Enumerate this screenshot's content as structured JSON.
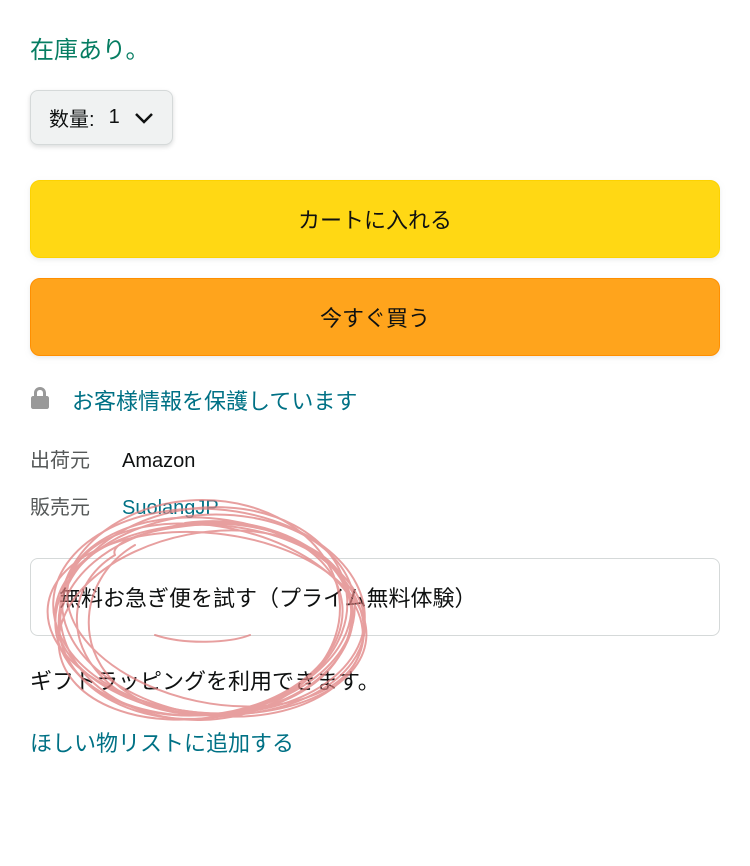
{
  "stock_status": "在庫あり。",
  "quantity": {
    "label": "数量:",
    "value": "1"
  },
  "buttons": {
    "add_to_cart": "カートに入れる",
    "buy_now": "今すぐ買う"
  },
  "secure": {
    "text": "お客様情報を保護しています"
  },
  "shipping": {
    "ships_from_label": "出荷元",
    "ships_from_value": "Amazon",
    "sold_by_label": "販売元",
    "sold_by_value": "SuolangJP"
  },
  "prime_trial": "無料お急ぎ便を試す（プライム無料体験）",
  "gift_wrap": "ギフトラッピングを利用できます。",
  "wishlist": "ほしい物リストに追加する"
}
